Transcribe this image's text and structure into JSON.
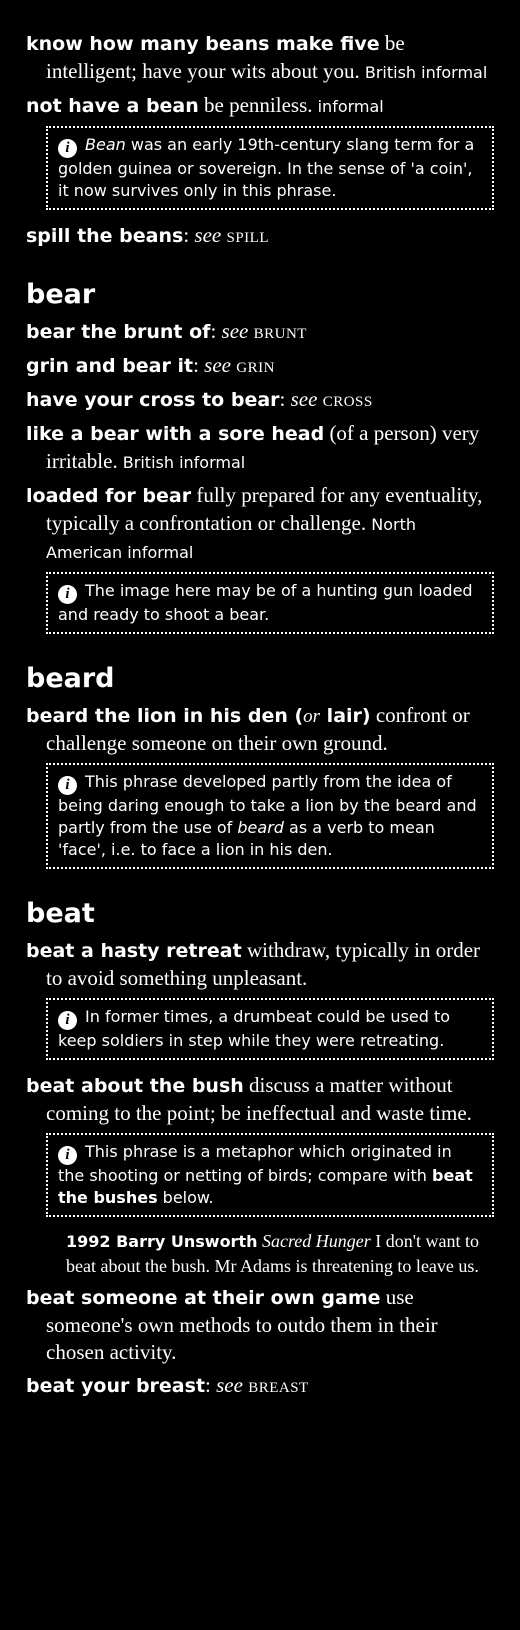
{
  "entries": {
    "e1": {
      "phrase": "know how many beans make five",
      "def": " be intelligent; have your wits about you.",
      "reg": " British informal"
    },
    "e2": {
      "phrase": "not have a bean",
      "def": " be penniless.",
      "reg": " informal"
    },
    "n1": {
      "italic": "Bean",
      "text": " was an early 19th-century slang term for a golden guinea or sovereign. In the sense of 'a coin', it now survives only in this phrase."
    },
    "e3": {
      "phrase": "spill the beans",
      "colon": ": ",
      "see": "see",
      "xref": "spill"
    },
    "h1": "bear",
    "e4": {
      "phrase": "bear the brunt of",
      "colon": ": ",
      "see": "see",
      "xref": "brunt"
    },
    "e5": {
      "phrase": "grin and bear it",
      "colon": ": ",
      "see": "see",
      "xref": "grin"
    },
    "e6": {
      "phrase": "have your cross to bear",
      "colon": ": ",
      "see": "see",
      "xref": "cross"
    },
    "e7": {
      "phrase": "like a bear with a sore head",
      "def": " (of a person) very irritable.",
      "reg": " British informal"
    },
    "e8": {
      "phrase": "loaded for bear",
      "def": " fully prepared for any eventuality, typically a confrontation or challenge.",
      "reg": " North American informal"
    },
    "n2": {
      "text": "The image here may be of a hunting gun loaded and ready to shoot a bear."
    },
    "h2": "beard",
    "e9": {
      "phrase_a": "beard the lion in his den (",
      "or": "or",
      "phrase_b": " lair)",
      "def": " confront or challenge someone on their own ground."
    },
    "n3": {
      "text_a": "This phrase developed partly from the idea of being daring enough to take a lion by the beard and partly from the use of ",
      "italic": "beard",
      "text_b": " as a verb to mean 'face', i.e. to face a lion in his den."
    },
    "h3": "beat",
    "e10": {
      "phrase": "beat a hasty retreat",
      "def": " withdraw, typically in order to avoid something unpleasant."
    },
    "n4": {
      "text": "In former times, a drumbeat could be used to keep soldiers in step while they were retreating."
    },
    "e11": {
      "phrase": "beat about the bush",
      "def": " discuss a matter without coming to the point; be ineffectual and waste time."
    },
    "n5": {
      "text_a": "This phrase is a metaphor which originated in the shooting or netting of birds; compare with ",
      "bold": "beat the bushes",
      "text_b": " below."
    },
    "q1": {
      "source": "1992 Barry Unsworth",
      "title": " Sacred Hunger",
      "text": " I don't want to beat about the bush. Mr Adams is threatening to leave us."
    },
    "e12": {
      "phrase": "beat someone at their own game",
      "def": " use someone's own methods to outdo them in their chosen activity."
    },
    "e13": {
      "phrase": "beat your breast",
      "colon": ": ",
      "see": "see",
      "xref": "breast"
    }
  },
  "icon": {
    "name": "info-icon",
    "glyph": "i"
  }
}
